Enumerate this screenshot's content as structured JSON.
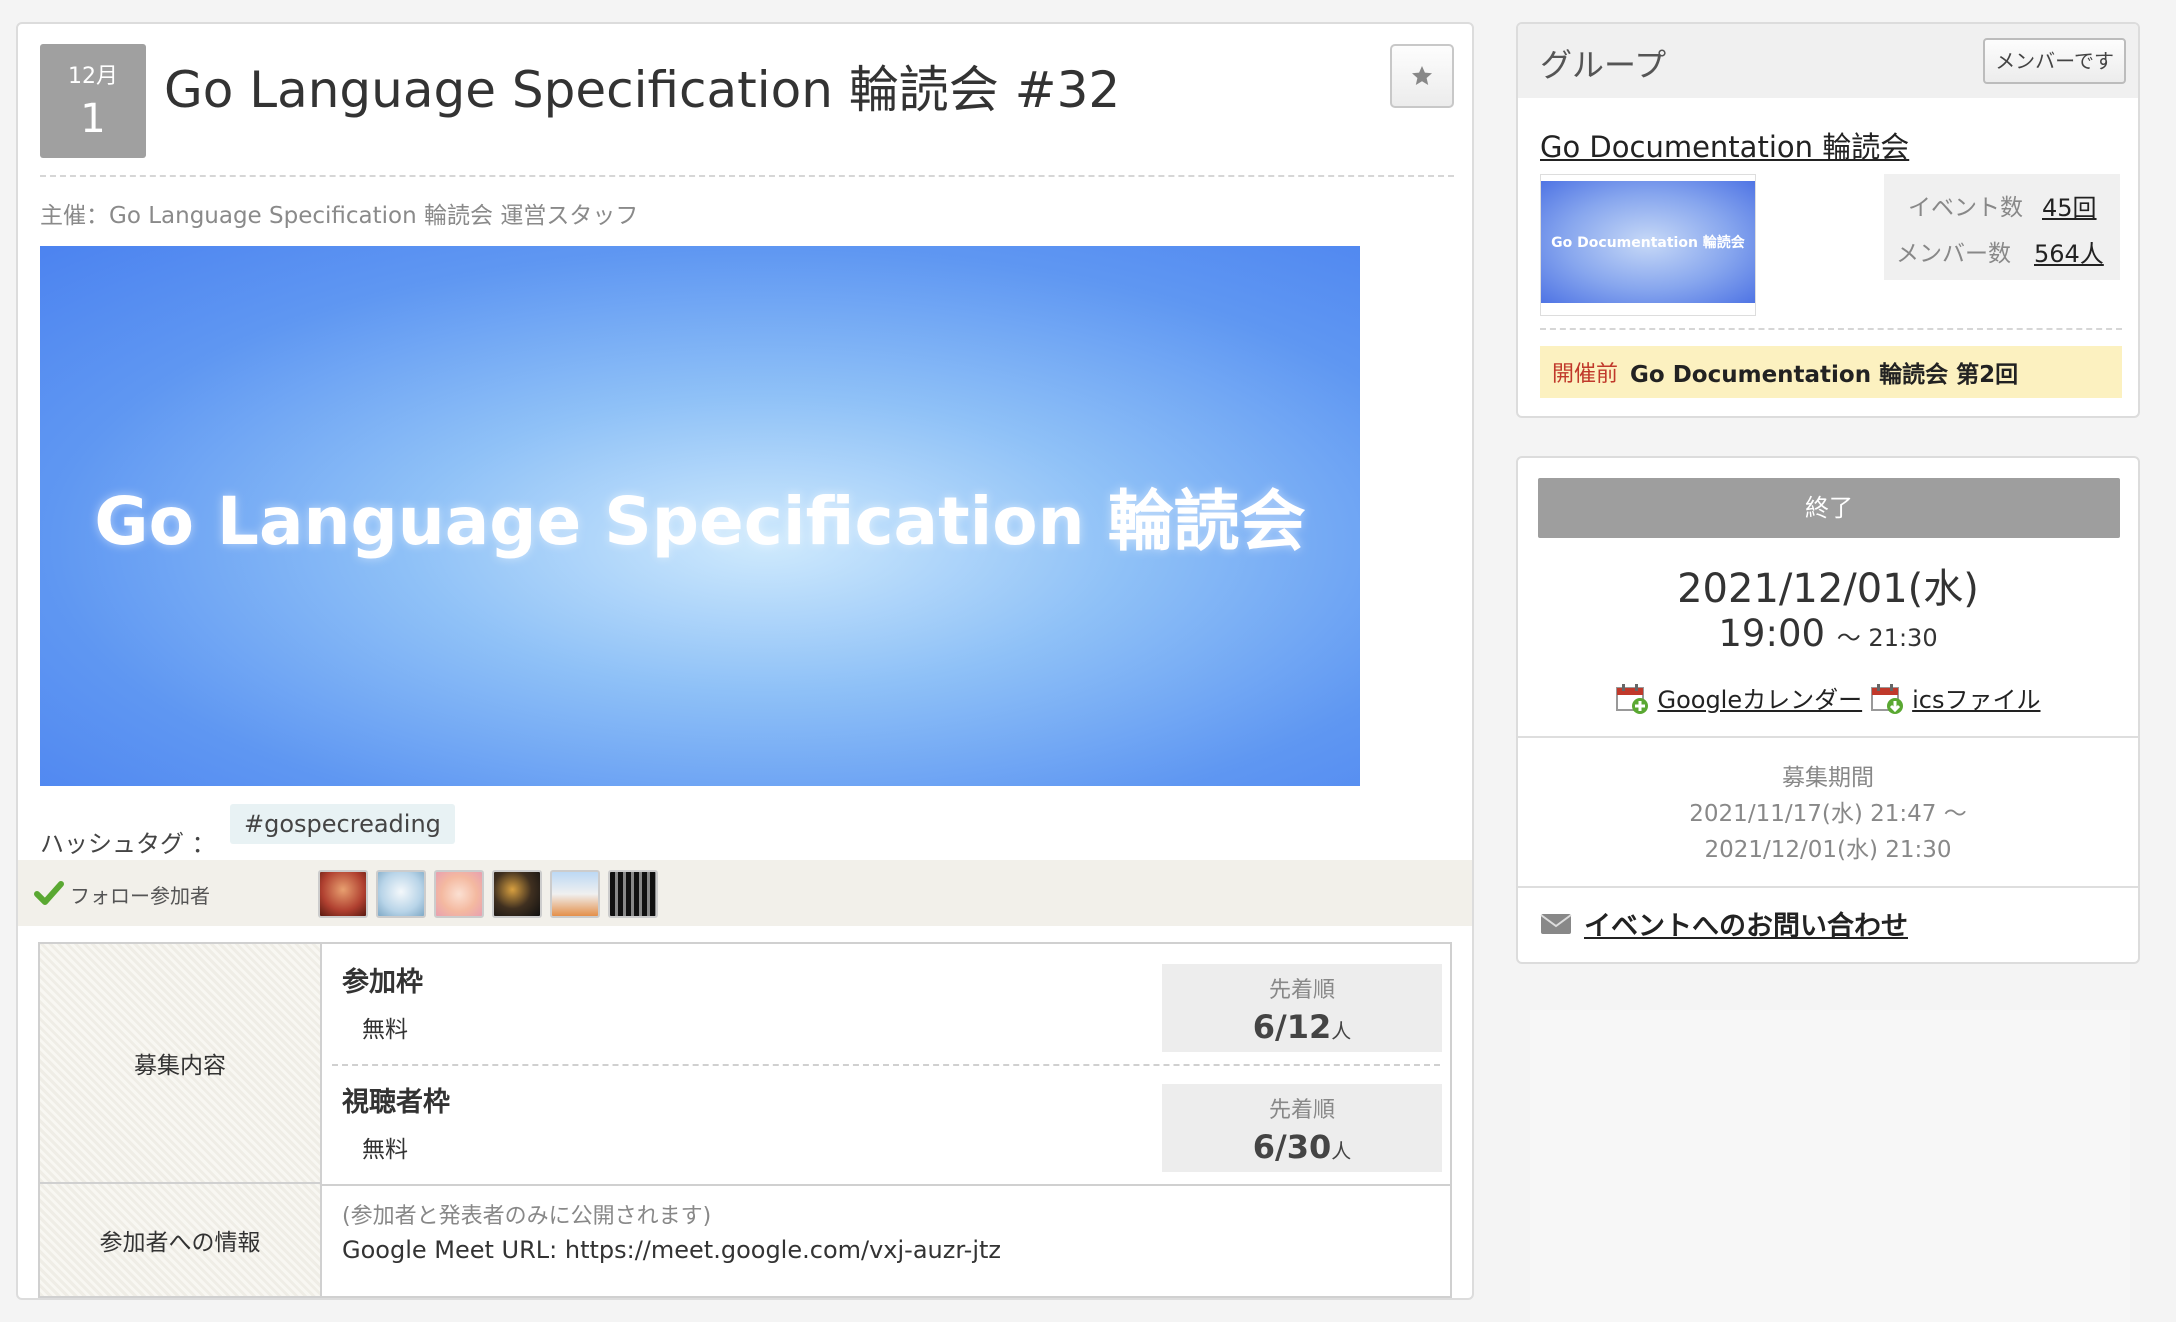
{
  "event": {
    "month": "12月",
    "day": "1",
    "title": "Go Language Specification 輪読会 #32",
    "organizer": "主催：Go Language Specification 輪読会 運営スタッフ",
    "image_text": "Go Language Specification 輪読会",
    "hashtag_label": "ハッシュタグ ：",
    "hashtag": "#gospecreading",
    "follow_label": "フォロー参加者"
  },
  "recruitment": {
    "row_label": "募集内容",
    "tickets": [
      {
        "name": "参加枠",
        "price": "無料",
        "method": "先着順",
        "count": "6/12",
        "unit": "人"
      },
      {
        "name": "視聴者枠",
        "price": "無料",
        "method": "先着順",
        "count": "6/30",
        "unit": "人"
      }
    ],
    "info_label": "参加者への情報",
    "info_note": "(参加者と発表者のみに公開されます)",
    "info_url": "Google Meet URL: https://meet.google.com/vxj-auzr-jtz"
  },
  "group": {
    "header": "グループ",
    "member_button": "メンバーです",
    "name": "Go Documentation 輪読会",
    "thumb_text": "Go Documentation 輪読会",
    "events_label": "イベント数",
    "events_value": "45回",
    "members_label": "メンバー数",
    "members_value": "564人",
    "next_status": "開催前",
    "next_title": "Go Documentation 輪読会 第2回"
  },
  "schedule": {
    "status": "終了",
    "date": "2021/12/01(水)",
    "start": "19:00",
    "end": "～ 21:30",
    "google_cal": "Googleカレンダー",
    "ics": "icsファイル",
    "period_label": "募集期間",
    "period_start": "2021/11/17(水) 21:47 ～",
    "period_end": "2021/12/01(水) 21:30",
    "contact": "イベントへのお問い合わせ"
  },
  "colors": {
    "accent_warning": "#c0392b",
    "notice_bg": "#fcf1c0",
    "status_gray": "#9e9e9e"
  },
  "icons": [
    "star-icon",
    "check-icon",
    "calendar-add-icon",
    "calendar-download-icon",
    "mail-icon"
  ]
}
